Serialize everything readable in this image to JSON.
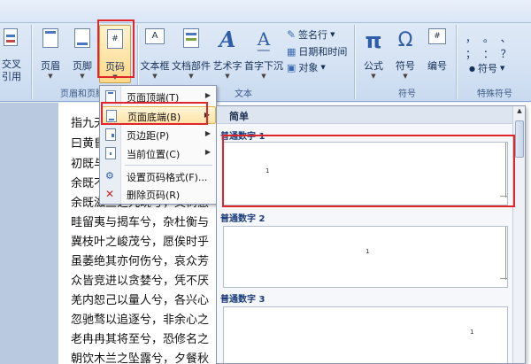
{
  "ribbon": {
    "cross_ref": {
      "line1": "交叉",
      "line2": "引用"
    },
    "header_footer_group": {
      "label": "页眉和页脚",
      "header_label": "页眉",
      "footer_label": "页脚",
      "page_number_label": "页码"
    },
    "text_group": {
      "label": "文本",
      "textbox_label": "文本框",
      "quickparts_label": "文档部件",
      "wordart_label": "艺术字",
      "dropcap_label": "首字下沉",
      "signature_label": "签名行",
      "datetime_label": "日期和时间",
      "object_label": "对象"
    },
    "symbols_group": {
      "label": "符号",
      "equation_label": "公式",
      "symbol_label": "符号",
      "number_label": "编号",
      "equation_glyph": "π",
      "symbol_glyph": "Ω"
    },
    "special_symbols_group": {
      "label": "特殊符号",
      "symbol_label": "符号",
      "glyphs_row1": "， 。 、",
      "glyphs_row2": "； ： ？"
    }
  },
  "page_number_menu": {
    "items": [
      {
        "label": "页面顶端(T)",
        "has_submenu": true
      },
      {
        "label": "页面底端(B)",
        "has_submenu": true
      },
      {
        "label": "页边距(P)",
        "has_submenu": true
      },
      {
        "label": "当前位置(C)",
        "has_submenu": true
      },
      {
        "label": "设置页码格式(F)...",
        "has_submenu": false
      },
      {
        "label": "删除页码(R)",
        "has_submenu": false
      }
    ],
    "highlighted": "页面底端(B)"
  },
  "gallery": {
    "header": "简单",
    "items": [
      {
        "title": "普通数字 1",
        "number": "1",
        "align": "left"
      },
      {
        "title": "普通数字 2",
        "number": "1",
        "align": "center"
      },
      {
        "title": "普通数字 3",
        "number": "1",
        "align": "right"
      }
    ]
  },
  "document": {
    "lines": [
      "指九天",
      "曰黄昏",
      "初既与",
      "余既不",
      "余既滋兰之九畹兮，又树蕙",
      "畦留夷与揭车兮，杂杜衡与",
      "冀枝叶之峻茂兮，愿俟时乎",
      "虽萎绝其亦何伤兮，哀众芳",
      "众皆竞进以贪婪兮，凭不厌",
      "羌内恕己以量人兮，各兴心",
      "忽驰骛以追逐兮，非余心之",
      "老冉冉其将至兮，恐修名之",
      "朝饮木兰之坠露兮，夕餐秋"
    ]
  },
  "colors": {
    "ribbon_bg": "#d7e4f4",
    "highlight_red": "#e0262b",
    "menu_hover": "#ffe4a6",
    "gallery_title": "#1a3b7a"
  }
}
